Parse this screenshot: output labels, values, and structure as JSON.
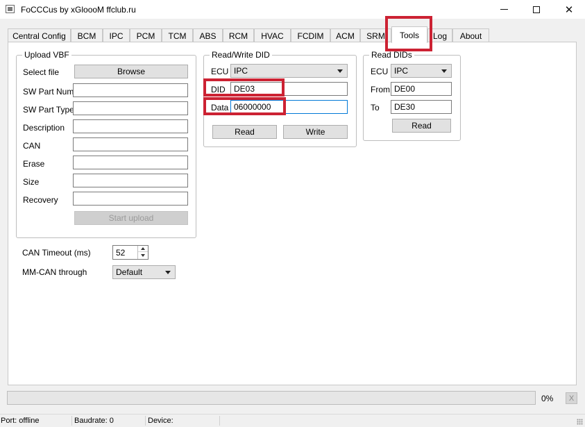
{
  "window": {
    "title": "FoCCCus by xGloooM ffclub.ru"
  },
  "tabs": [
    "Central Config",
    "BCM",
    "IPC",
    "PCM",
    "TCM",
    "ABS",
    "RCM",
    "HVAC",
    "FCDIM",
    "ACM",
    "SRM",
    "Tools",
    "Log",
    "About"
  ],
  "active_tab": "Tools",
  "upload_vbf": {
    "title": "Upload VBF",
    "select_file_label": "Select file",
    "browse_label": "Browse",
    "fields": [
      {
        "label": "SW Part Num",
        "value": ""
      },
      {
        "label": "SW Part Type",
        "value": ""
      },
      {
        "label": "Description",
        "value": ""
      },
      {
        "label": "CAN",
        "value": ""
      },
      {
        "label": "Erase",
        "value": ""
      },
      {
        "label": "Size",
        "value": ""
      },
      {
        "label": "Recovery",
        "value": ""
      }
    ],
    "start_upload_label": "Start upload"
  },
  "can_timeout": {
    "label": "CAN Timeout (ms)",
    "value": "52"
  },
  "mm_can": {
    "label": "MM-CAN through",
    "value": "Default"
  },
  "read_write_did": {
    "title": "Read/Write DID",
    "ecu_label": "ECU",
    "ecu_value": "IPC",
    "did_label": "DID",
    "did_value": "DE03",
    "data_label": "Data",
    "data_value": "06000000",
    "read_label": "Read",
    "write_label": "Write"
  },
  "read_dids": {
    "title": "Read DIDs",
    "ecu_label": "ECU",
    "ecu_value": "IPC",
    "from_label": "From",
    "from_value": "DE00",
    "to_label": "To",
    "to_value": "DE30",
    "read_label": "Read"
  },
  "progress": {
    "percent_text": "0%",
    "value": 0,
    "cancel_label": "X"
  },
  "status": {
    "port": "Port: offline",
    "baudrate": "Baudrate: 0",
    "device": "Device:"
  },
  "colors": {
    "highlight": "#cc2233",
    "focus": "#0078d7",
    "panel": "#ffffff",
    "window": "#f0f0f0"
  }
}
